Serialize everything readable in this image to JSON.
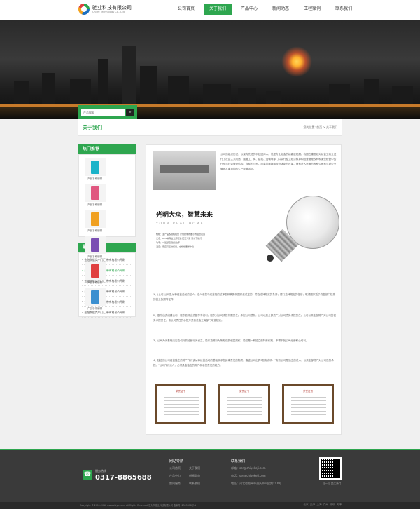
{
  "header": {
    "logo_cn": "驰业科技有限公司",
    "logo_en": "Chi Ye Technology Co., Ltd.",
    "nav": [
      "公司首页",
      "关于我们",
      "产品中心",
      "新闻动态",
      "工程案例",
      "联系我们"
    ],
    "active_nav": "关于我们",
    "accent": "#2ea64f"
  },
  "search": {
    "placeholder": "产品搜索",
    "button_icon": "search-icon"
  },
  "breadcrumb": {
    "title": "关于我们",
    "path": "您的位置: 首页 > 关于我们"
  },
  "sidebar": {
    "products_title": "热门推荐",
    "products": [
      {
        "caption": "产品名称编辑",
        "color": "#1bb3c9"
      },
      {
        "caption": "产品名称编辑",
        "color": "#e05780"
      },
      {
        "caption": "产品名称编辑",
        "color": "#f0a020"
      },
      {
        "caption": "产品名称编辑",
        "color": "#7a4fb3"
      },
      {
        "caption": "产品名称编辑",
        "color": "#e04040"
      },
      {
        "caption": "产品名称编辑",
        "color": "#3a8fd0"
      }
    ],
    "news_title": "最新动态",
    "news": [
      "金融数据类产门汇 带有格易价开刷",
      "金融数据类产门汇 带有格易价开刷",
      "金融数据类产门汇 带有格易价开刷",
      "金融数据类产门汇 带有格易价开刷",
      "金融数据类产门汇 带有格易价开刷",
      "金融数据类产门汇 带有格易价开刷"
    ]
  },
  "main": {
    "intro": "公司的组织形式，以某有先进的科技团体人。他是专业化会的格高度发展。我国在建国后对私营工商业进行了社会主义改造。国营工、商、建筑、运输等部门并实行独立经济核算和经营管理权利和某些经营中的行业与社会管理结构。当前的公司。改革英雄数国经济体制的改革。兼有法人资格的各种公司形式对企业管理从事目前的生产经营活动。",
    "slogan": "光明大众，智慧未来",
    "slogan_en": "YOUR REAL HOME",
    "specs": [
      "规格：主产品各规格组合 计划要求所要示的组合范围",
      "光色：6~8种专业光源可选 配套光源 高效节能灯",
      "功率：一般额定 建议功率",
      "温度：家庭可正常使用，在规格要求中指"
    ],
    "paragraphs": [
      "1、(公司)公司是从事经营活动的法人，法人承担与经营相的法律都和事属和国家依法定的，符合法律规定的条件，履行法律规定的程序，取得国家授予的各部门核发的营业执照等证件。",
      "2、股东出资组建公司，股东依其出资额享有权利，股东对公司承担有限责任。承担公司债务，公司以其全部资产对公司债务承担责任。公司以其全部财产对公司的债务承担责任，该公司责任的承担方式依法由工商部门审查核准。",
      "3、公司为为基础法定由权利的经营行为设立，股东投资行为所形成的权益规权，股权是一种独立的特殊权利，不得干扰公司经营和公司利。",
      "4、独立的公司经营独立的财产作为该从事经营活动的基础和承担民事责任的物质，高盛公司出具3张有说明：\"有所公司是独立的法人，以其全部资产对公司债务承担。\"公司作为法人，必须具备独立的财产和承担责任的能力。"
    ],
    "certs": [
      "荣誉证书",
      "荣誉证书",
      "荣誉证书"
    ]
  },
  "footer": {
    "hotline_label": "服务热线",
    "hotline": "0317-8865688",
    "col1_title": "网站导航",
    "col1_links": [
      "公司首页",
      "关于我们",
      "产品中心",
      "新闻动态",
      "赞同服务",
      "联系我们"
    ],
    "col2_title": "联系我们",
    "col2_links": [
      "邮箱：ser@chiyekeji.com",
      "电话：ser@chiyekeji.com",
      "地址：河北省沧州市泊头市人民路XXX号"
    ],
    "follow": "扫一扫 关注我们",
    "copyright": "Copyright © 2011-2018 www.chiye.com. All Rights Reserved  泊头市驰业科技有限公司  备案号12345678号-1",
    "cities": [
      "北京",
      "天津",
      "上海",
      "广州",
      "深圳",
      "天津"
    ]
  }
}
